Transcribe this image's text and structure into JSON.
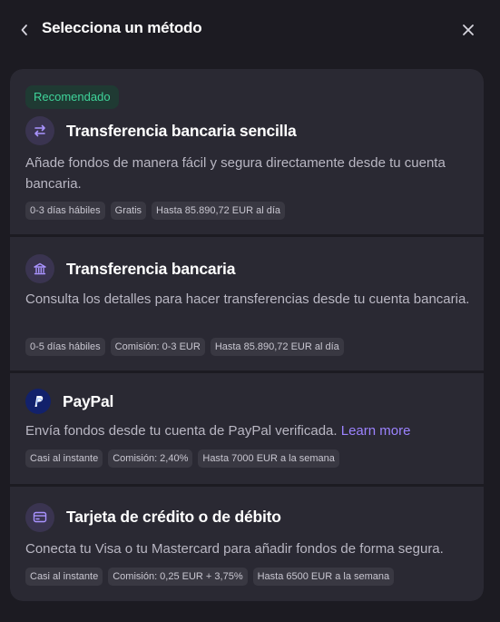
{
  "header": {
    "title": "Selecciona un método"
  },
  "methods": [
    {
      "badge": "Recomendado",
      "icon": "arrows-exchange-icon",
      "title": "Transferencia bancaria sencilla",
      "description": "Añade fondos de manera fácil y segura directamente desde tu cuenta bancaria.",
      "tags": [
        "0-3 días hábiles",
        "Gratis",
        "Hasta 85.890,72 EUR al día"
      ]
    },
    {
      "icon": "bank-icon",
      "title": "Transferencia bancaria",
      "description": "Consulta los detalles para hacer transferencias desde tu cuenta bancaria.",
      "tags": [
        "0-5 días hábiles",
        "Comisión: 0-3 EUR",
        "Hasta 85.890,72 EUR al día"
      ]
    },
    {
      "icon": "paypal-icon",
      "title": "PayPal",
      "description": "Envía fondos desde tu cuenta de PayPal verificada.",
      "link": "Learn more",
      "tags": [
        "Casi al instante",
        "Comisión: 2,40%",
        "Hasta 7000 EUR a la semana"
      ]
    },
    {
      "icon": "credit-card-icon",
      "title": "Tarjeta de crédito o de débito",
      "description": "Conecta tu Visa o tu Mastercard para añadir fondos de forma segura.",
      "tags": [
        "Casi al instante",
        "Comisión: 0,25 EUR + 3,75%",
        "Hasta 6500 EUR a la semana"
      ]
    }
  ],
  "colors": {
    "background": "#1c1b22",
    "card": "#2a2933",
    "badge_text": "#3fd49a",
    "link": "#9c83ff"
  }
}
